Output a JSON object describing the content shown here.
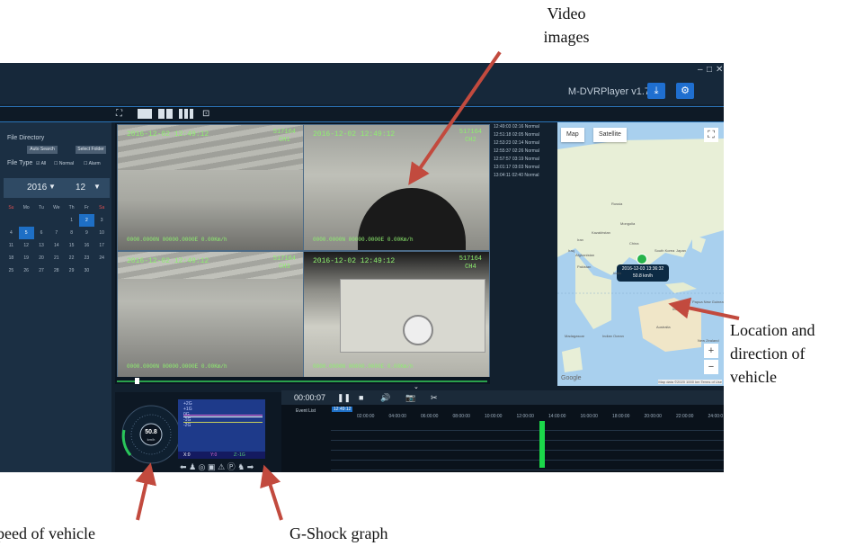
{
  "annotations": {
    "video": "Video\nimages",
    "location": "Location and\ndirection of\nvehicle",
    "speed": "Speed of vehicle",
    "gshock": "G-Shock graph"
  },
  "app": {
    "title": "M-DVRPlayer v1.7",
    "window_controls": [
      "–",
      "□",
      "✕"
    ],
    "toolbar_icons": [
      "download-icon",
      "gear-icon"
    ]
  },
  "layout_bar": {
    "icons": [
      "fullscreen-icon",
      "single-view-icon",
      "quad-view-icon",
      "nine-view-icon",
      "screen-icon"
    ]
  },
  "left_panel": {
    "file_directory_label": "File Directory",
    "auto_search": "Auto Search",
    "select_folder": "Select Folder",
    "file_type_label": "File Type",
    "file_types": [
      "All",
      "Normal",
      "Alarm"
    ],
    "file_types_checked": [
      true,
      false,
      false
    ],
    "year": "2016",
    "month": "12",
    "weekdays": [
      "Su",
      "Mo",
      "Tu",
      "We",
      "Th",
      "Fr",
      "Sa"
    ],
    "calendar_rows": [
      [
        "",
        "",
        "",
        "",
        "1",
        "2",
        "3"
      ],
      [
        "4",
        "5",
        "6",
        "7",
        "8",
        "9",
        "10"
      ],
      [
        "11",
        "12",
        "13",
        "14",
        "15",
        "16",
        "17"
      ],
      [
        "18",
        "19",
        "20",
        "21",
        "22",
        "23",
        "24"
      ],
      [
        "25",
        "26",
        "27",
        "28",
        "29",
        "30",
        ""
      ]
    ],
    "highlighted_days": [
      "2",
      "5"
    ]
  },
  "cameras": [
    {
      "timestamp": "2016-12-02 12:49:12",
      "id": "517164\nCH1",
      "gps": "0000.0000N 00000.0000E   0.00Km/h"
    },
    {
      "timestamp": "2016-12-02 12:49:12",
      "id": "517164\nCH2",
      "gps": "0000.0000N 00000.0000E   0.00Km/h"
    },
    {
      "timestamp": "2016-12-02 12:49:12",
      "id": "517164\nCH3",
      "gps": "0000.0000N 00000.0000E   0.00Km/h"
    },
    {
      "timestamp": "2016-12-02 12:49:12",
      "id": "517164\nCH4",
      "gps": "0000.0000N 00000.0000E   0.00Km/h"
    }
  ],
  "event_list_items": [
    "12:49:03 02:16 Normal",
    "12:51:18 02:05 Normal",
    "12:53:23 02:14 Normal",
    "12:55:37 02:26 Normal",
    "12:57:57 03:19 Normal",
    "13:01:17 03:03 Normal",
    "13:04:11 02:40 Normal"
  ],
  "map": {
    "tab_map": "Map",
    "tab_satellite": "Satellite",
    "popup_time": "2016-12-03 13:36:32",
    "popup_speed": "50.8 km/h",
    "footer": "Map data ©2020   1000 km   Terms of Use",
    "google": "Google",
    "zoom_in": "+",
    "zoom_out": "−",
    "labels": [
      "Russia",
      "Mongolia",
      "Kazakhstan",
      "China",
      "Japan",
      "India",
      "Indonesia",
      "Australia",
      "Papua New Guinea",
      "Afghanistan",
      "Pakistan",
      "Madagascar",
      "Indian Ocean",
      "South Korea",
      "Iran",
      "Iraq",
      "New Zealand"
    ]
  },
  "controls": {
    "time": "00:00:07",
    "buttons": [
      "pause-icon",
      "stop-icon",
      "volume-icon",
      "camera-icon",
      "scissors-icon"
    ]
  },
  "timeline": {
    "event_list_label": "Event List",
    "current_time": "12:49:12",
    "ticks": [
      "02:00:00",
      "04:00:00",
      "06:00:00",
      "08:00:00",
      "10:00:00",
      "12:00:00",
      "14:00:00",
      "16:00:00",
      "18:00:00",
      "20:00:00",
      "22:00:00",
      "24:00:0"
    ]
  },
  "speedometer": {
    "speed": "50.8",
    "unit": "km/h",
    "scale": [
      "0",
      "20",
      "40",
      "60",
      "80",
      "100",
      "120",
      "140",
      "160",
      "180",
      "200",
      "220",
      "240"
    ]
  },
  "gshock": {
    "lines": [
      "+2G",
      "+1G",
      "0G",
      "-1G",
      "-2G"
    ],
    "footer": [
      "X:0",
      "Y:0",
      "Z:-1G"
    ]
  },
  "status_icons": [
    "left-turn-icon",
    "seatbelt-icon",
    "brake-icon",
    "camera-icon",
    "warning-icon",
    "parking-icon",
    "reverse-icon",
    "right-turn-icon"
  ],
  "colors": {
    "accent": "#1e6fc5",
    "osd": "#8ef06f",
    "timeline_marker": "#1bd84a",
    "arrow": "#c24a3e"
  }
}
